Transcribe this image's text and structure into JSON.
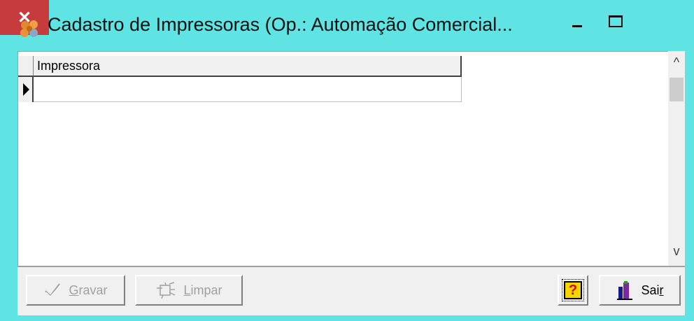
{
  "window": {
    "title": "Cadastro de Impressoras (Op.: Automação Comercial...",
    "icon": "cog-flower-icon",
    "controls": {
      "minimize": "–",
      "maximize": "□",
      "close": "✕"
    }
  },
  "grid": {
    "columns": [
      "Impressora"
    ],
    "rows": [
      {
        "Impressora": ""
      }
    ]
  },
  "scrollbar": {
    "up": "^",
    "down": "v"
  },
  "buttons": {
    "gravar": {
      "label_prefix": "",
      "label_accel": "G",
      "label_rest": "ravar",
      "enabled": false,
      "icon": "check-icon"
    },
    "limpar": {
      "label_prefix": "",
      "label_accel": "L",
      "label_rest": "impar",
      "enabled": false,
      "icon": "broom-icon"
    },
    "help": {
      "label": "?",
      "icon": "help-icon"
    },
    "sair": {
      "label_prefix": "Sai",
      "label_accel": "r",
      "label_rest": "",
      "enabled": true,
      "icon": "exit-door-icon"
    }
  },
  "colors": {
    "titlebar": "#5fe3e3",
    "close": "#c63b3b",
    "face": "#f0f0f0"
  }
}
